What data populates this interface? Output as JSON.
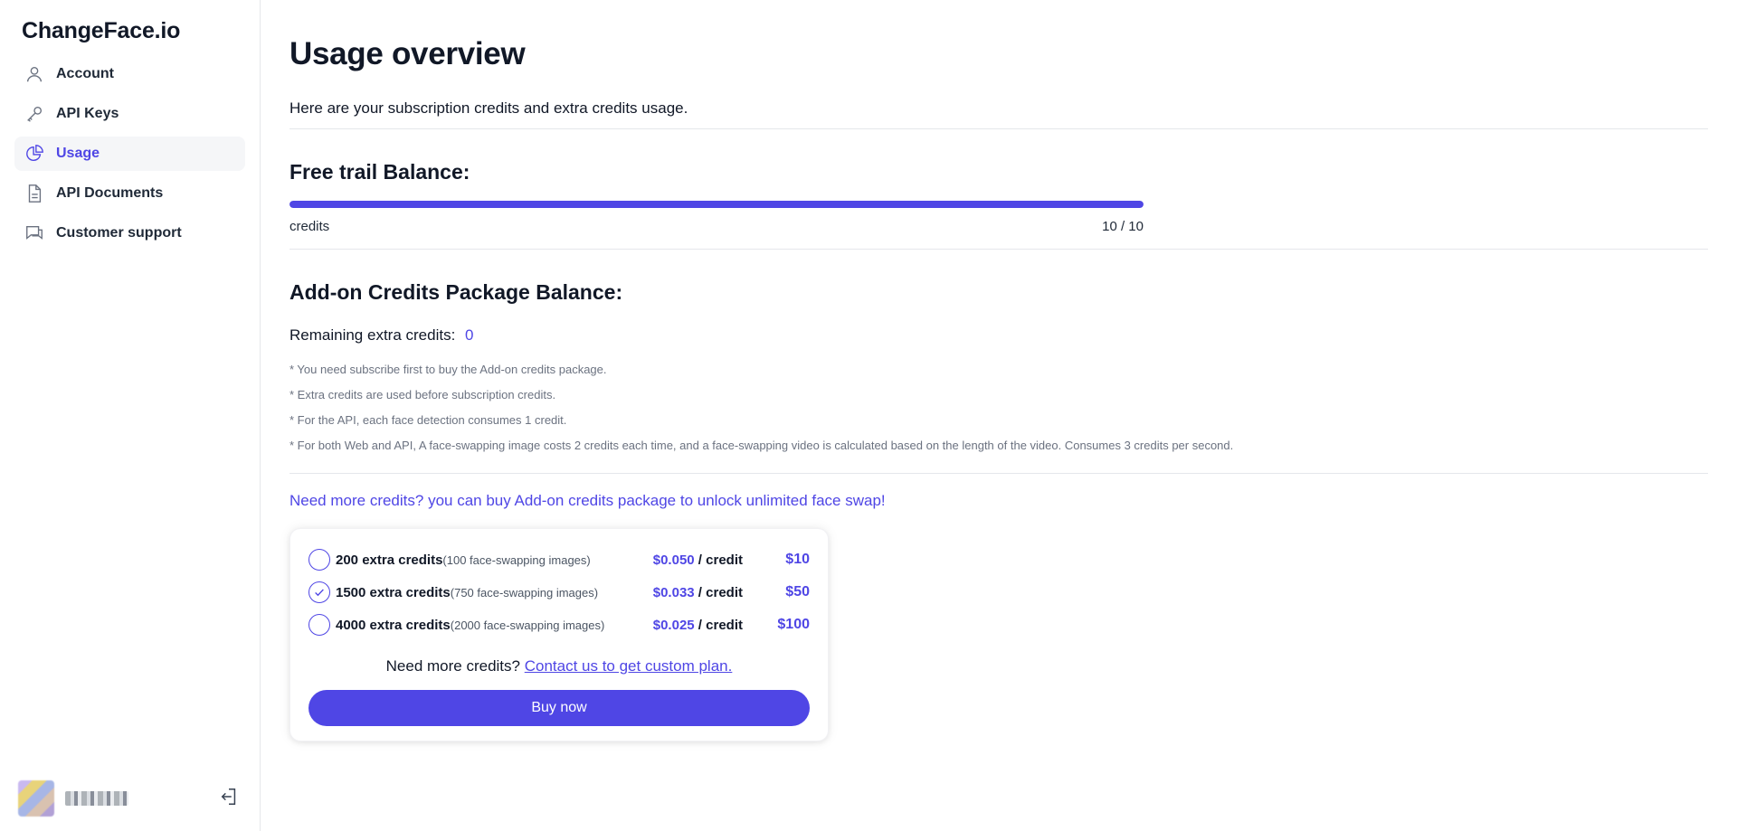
{
  "app": {
    "logo": "ChangeFace.io"
  },
  "sidebar": {
    "items": [
      {
        "label": "Account",
        "icon": "user-icon"
      },
      {
        "label": "API Keys",
        "icon": "key-icon"
      },
      {
        "label": "Usage",
        "icon": "pie-chart-icon",
        "active": true
      },
      {
        "label": "API Documents",
        "icon": "document-icon"
      },
      {
        "label": "Customer support",
        "icon": "chat-icon"
      }
    ]
  },
  "main": {
    "title": "Usage overview",
    "intro": "Here are your subscription credits and extra credits usage.",
    "free_trial": {
      "title": "Free trail Balance:",
      "label": "credits",
      "value": "10 / 10",
      "used": 10,
      "total": 10
    },
    "addon": {
      "title": "Add-on Credits Package Balance:",
      "remaining_label": "Remaining extra credits:",
      "remaining_value": "0",
      "notes": [
        "* You need subscribe first to buy the Add-on credits package.",
        "* Extra credits are used before subscription credits.",
        "* For the API, each face detection consumes 1 credit.",
        "* For both Web and API, A face-swapping image costs 2 credits each time, and a face-swapping video is calculated based on the length of the video. Consumes 3 credits per second."
      ]
    },
    "promo": "Need more credits? you can buy Add-on credits package to unlock unlimited face swap!",
    "packages": [
      {
        "name": "200 extra credits",
        "sub": "(100 face-swapping images)",
        "unit_price": "$0.050",
        "unit_suffix": " / credit",
        "total": "$10",
        "selected": false
      },
      {
        "name": "1500 extra credits",
        "sub": "(750 face-swapping images)",
        "unit_price": "$0.033",
        "unit_suffix": " / credit",
        "total": "$50",
        "selected": true
      },
      {
        "name": "4000 extra credits",
        "sub": "(2000 face-swapping images)",
        "unit_price": "$0.025",
        "unit_suffix": " / credit",
        "total": "$100",
        "selected": false
      }
    ],
    "custom_text": "Need more credits?",
    "custom_link": "Contact us to get custom plan.",
    "buy_label": "Buy now"
  },
  "colors": {
    "accent": "#4f46e5",
    "text": "#111827",
    "muted": "#6b7280",
    "divider": "#e5e7eb"
  }
}
